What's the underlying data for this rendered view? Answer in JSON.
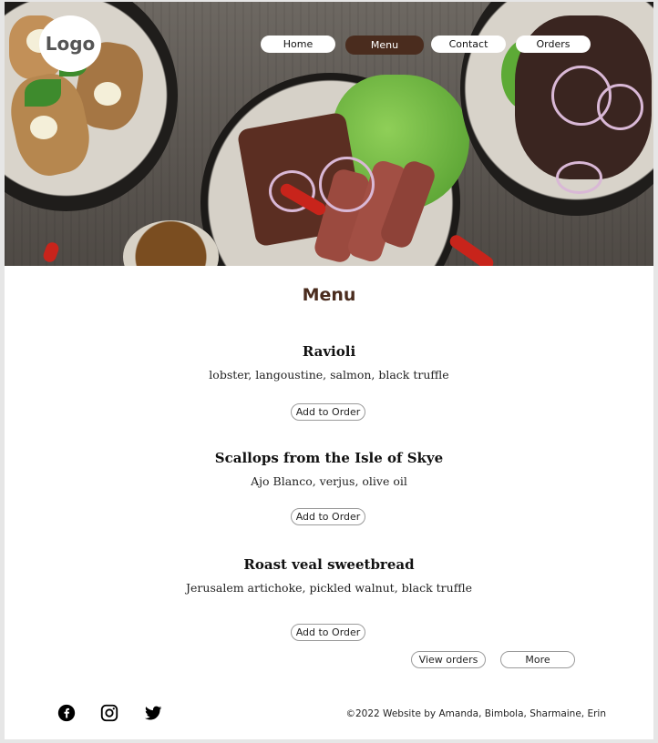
{
  "header": {
    "logo_text": "Logo",
    "nav": [
      {
        "label": "Home",
        "active": false
      },
      {
        "label": "Menu",
        "active": true
      },
      {
        "label": "Contact",
        "active": false
      },
      {
        "label": "Orders",
        "active": false
      }
    ]
  },
  "menu": {
    "title": "Menu",
    "dishes": [
      {
        "name": "Ravioli",
        "description": "lobster, langoustine, salmon, black truffle",
        "button": "Add to Order"
      },
      {
        "name": "Scallops from the Isle of Skye",
        "description": "Ajo Blanco, verjus, olive oil",
        "button": "Add to Order"
      },
      {
        "name": "Roast veal sweetbread",
        "description": "Jerusalem artichoke, pickled walnut, black truffle",
        "button": "Add to Order"
      }
    ],
    "view_orders_label": "View orders",
    "more_label": "More"
  },
  "footer": {
    "social_icons": [
      "facebook-icon",
      "instagram-icon",
      "twitter-icon"
    ],
    "copyright": "©2022 Website by Amanda, Bimbola, Sharmaine, Erin"
  },
  "colors": {
    "accent_brown": "#4a2c1e",
    "background": "#ffffff",
    "page_gutter": "#e6e6e6"
  }
}
